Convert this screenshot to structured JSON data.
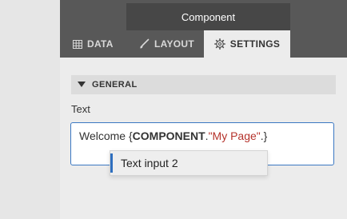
{
  "header": {
    "title": "Component"
  },
  "tabs": [
    {
      "label": "DATA",
      "icon": "table-icon"
    },
    {
      "label": "LAYOUT",
      "icon": "brush-icon"
    },
    {
      "label": "SETTINGS",
      "icon": "gear-icon",
      "active": true
    }
  ],
  "section": {
    "title": "GENERAL",
    "expanded": true
  },
  "field": {
    "label": "Text",
    "value_parts": [
      "Welcome {",
      "COMPONENT",
      ".",
      "\"My Page\"",
      ".}"
    ]
  },
  "autocomplete": {
    "items": [
      "Text input 2"
    ]
  },
  "colors": {
    "header_bg": "#585858",
    "accent": "#3b78c2",
    "string": "#b5322b"
  }
}
